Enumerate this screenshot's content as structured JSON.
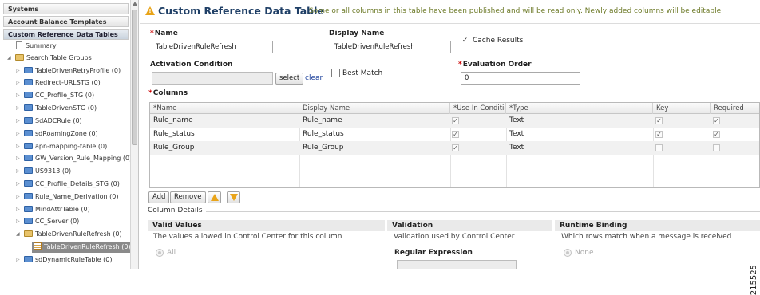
{
  "sidebar": {
    "accordion": [
      "Systems",
      "Account Balance Templates",
      "Custom Reference Data Tables"
    ],
    "tree": {
      "summary": "Summary",
      "group": "Search Table Groups",
      "items": [
        "TableDrivenRetryProfile (0)",
        "Redirect-URLSTG (0)",
        "CC_Profile_STG (0)",
        "TableDrivenSTG (0)",
        "SdADCRule (0)",
        "sdRoamingZone (0)",
        "apn-mapping-table (0)",
        "GW_Version_Rule_Mapping (0)",
        "US9313 (0)",
        "CC_Profile_Details_STG (0)",
        "Rule_Name_Derivation (0)",
        "MindAttrTable (0)",
        "CC_Server (0)",
        "TableDrivenRuleRefresh (0)",
        "TableDrivenRuleRefresh (0)",
        "sdDynamicRuleTable (0)"
      ]
    }
  },
  "header": {
    "title": "Custom Reference Data Table",
    "note": "Some or all columns in this table have been published and will be read only. Newly added columns will be editable."
  },
  "form": {
    "name_label": "Name",
    "name_value": "TableDrivenRuleRefresh",
    "display_name_label": "Display Name",
    "display_name_value": "TableDrivenRuleRefresh",
    "cache_results_label": "Cache Results",
    "activation_label": "Activation Condition",
    "activation_value": "",
    "select_label": "select",
    "clear_label": "clear",
    "best_match_label": "Best Match",
    "eval_order_label": "Evaluation Order",
    "eval_order_value": "0"
  },
  "columns": {
    "label": "Columns",
    "headers": [
      "*Name",
      "Display Name",
      "*Use In Conditions",
      "*Type",
      "Key",
      "Required"
    ],
    "rows": [
      {
        "name": "Rule_name",
        "display": "Rule_name",
        "use": "✓",
        "type": "Text",
        "key": "✓",
        "required": "✓"
      },
      {
        "name": "Rule_status",
        "display": "Rule_status",
        "use": "✓",
        "type": "Text",
        "key": "✓",
        "required": "✓"
      },
      {
        "name": "Rule_Group",
        "display": "Rule_Group",
        "use": "✓",
        "type": "Text",
        "key": "",
        "required": ""
      }
    ],
    "add_label": "Add",
    "remove_label": "Remove"
  },
  "details": {
    "section_label": "Column Details",
    "valid_values": {
      "title": "Valid Values",
      "desc": "The values allowed in Control Center for this column",
      "option": "All"
    },
    "validation": {
      "title": "Validation",
      "desc": "Validation used by Control Center",
      "regex_label": "Regular Expression"
    },
    "runtime": {
      "title": "Runtime Binding",
      "desc": "Which rows match when a message is received",
      "option": "None"
    }
  },
  "figure_id": "215525"
}
